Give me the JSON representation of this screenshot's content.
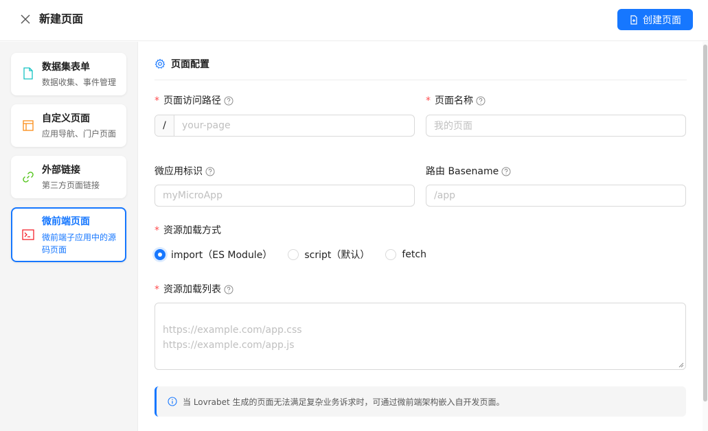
{
  "header": {
    "title": "新建页面",
    "create_button": "创建页面"
  },
  "sidebar": {
    "items": [
      {
        "title": "数据集表单",
        "desc": "数据收集、事件管理",
        "icon": "document-icon",
        "color": "#13c2c2"
      },
      {
        "title": "自定义页面",
        "desc": "应用导航、门户页面",
        "icon": "layout-icon",
        "color": "#fa8c16"
      },
      {
        "title": "外部链接",
        "desc": "第三方页面链接",
        "icon": "link-icon",
        "color": "#52c41a"
      },
      {
        "title": "微前端页面",
        "desc": "微前端子应用中的源码页面",
        "icon": "code-icon",
        "color": "#f5222d",
        "active": true
      }
    ]
  },
  "form": {
    "section_title": "页面配置",
    "path_label": "页面访问路径",
    "path_prefix": "/",
    "path_placeholder": "your-page",
    "name_label": "页面名称",
    "name_placeholder": "我的页面",
    "micro_label": "微应用标识",
    "micro_placeholder": "myMicroApp",
    "basename_label": "路由 Basename",
    "basename_placeholder": "/app",
    "load_mode_label": "资源加载方式",
    "load_modes": [
      {
        "label": "import（ES Module）",
        "checked": true
      },
      {
        "label": "script（默认）",
        "checked": false
      },
      {
        "label": "fetch",
        "checked": false
      }
    ],
    "resources_label": "资源加载列表",
    "resources_placeholder": "https://example.com/app.css\nhttps://example.com/app.js",
    "notice": "当 Lovrabet 生成的页面无法满足复杂业务诉求时，可通过微前端架构嵌入自开发页面。"
  },
  "colors": {
    "accent": "#1677ff",
    "required": "#ff4d4f"
  }
}
